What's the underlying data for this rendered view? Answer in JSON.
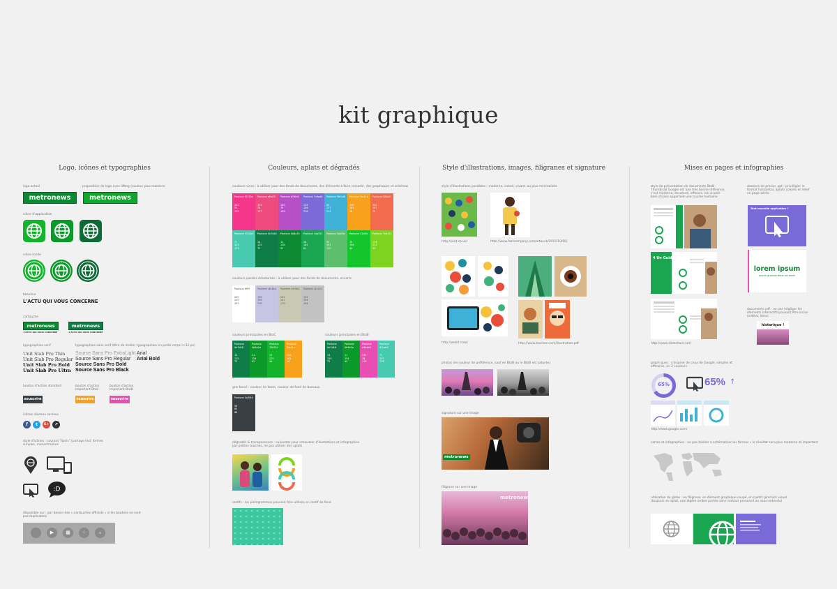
{
  "page": {
    "title": "kit graphique"
  },
  "columns": [
    "Logo, icônes et typographies",
    "Couleurs, aplats et dégradés",
    "Style d'illustrations, images, filigranes et signature",
    "Mises en pages et infographies"
  ],
  "col1": {
    "logo_actuel": "logo actuel",
    "logo_proposition": "proposition de logo avec lifting (couleur plus moderne",
    "logo_text": "metronews",
    "icone_application": "icône d'application",
    "icone_ronde": "icône ronde",
    "baseline_label": "baseline",
    "baseline_text": "L'ACTU QUI VOUS CONCERNE",
    "cartouche_label": "cartouche",
    "cartouche_sub": "L'ACTU QUI VOUS CONCERNE",
    "typo_serif": "typographies serif",
    "typo_sans": "typographies sans serif (titre de droite)",
    "typo_petit": "typographies en petits corps (<12 px)",
    "serif_fonts": [
      "Unit Slab Pro Thin",
      "Unit Slab Pro Regular",
      "Unit Slab Pro Bold",
      "Unit Slab Pro Ultra"
    ],
    "sans_fonts": [
      "Source Sans Pro ExtraLight",
      "Source Sans Pro Regular",
      "Source Sans Pro Bold",
      "Source Sans Pro Black"
    ],
    "small_fonts": [
      "Arial",
      "Arial Bold"
    ],
    "btn_labels": [
      "bouton d'action standard",
      "bouton d'action important BtoC",
      "bouton d'action important BtoB"
    ],
    "btn_text": "souscrire",
    "icones_sociaux": "icônes réseaux sociaux",
    "style_icones": "style d'icônes : courant \"lipsis\" (partage lisd, formes simples, monochromes",
    "disponible": "disponible sur : par besoin des « cartouches officiels » si les boutons ne sont pas duplicables"
  },
  "col2": {
    "couleurs_label": "couleurs vives : à utiliser pour des fonds de documents, des éléments à faire ressortir, des graphiques et schémas",
    "pastels_label": "couleurs pastels désaturées : à utiliser pour des fonds de documents, encarts",
    "btoc_label": "couleurs principales en BtoC",
    "btob_label": "couleurs principales en BtoB",
    "gris_label": "gris foncé : couleur de texte, couleur de fond de bureaux",
    "degrades_label": "dégradés & transparences : suivantes pour rehausser d'ilustrations et infographies par petites touches, ne pas utiliser des aplats",
    "motifs_label": "motifs : les pictogrammes peuvent être utilisés en motif de fond",
    "swatch_name": "Pantone",
    "row1": [
      {
        "c": "#f5358a",
        "hex": "f5358a",
        "rgb": "245 53 138"
      },
      {
        "c": "#ef4a7f",
        "hex": "ef4a7f",
        "rgb": "239 74 127"
      },
      {
        "c": "#b74fc6",
        "hex": "b74fc6",
        "rgb": "183 79 198"
      },
      {
        "c": "#7c6ad8",
        "hex": "7c6ad8",
        "rgb": "124 106 216"
      },
      {
        "c": "#3fb1d6",
        "hex": "3fb1d6",
        "rgb": "63 177 214"
      },
      {
        "c": "#f9a11a",
        "hex": "f9a11a",
        "rgb": "249 161 26"
      },
      {
        "c": "#f26b4f",
        "hex": "f26b4f",
        "rgb": "242 107 79"
      }
    ],
    "row2": [
      {
        "c": "#47cbb0",
        "hex": "47cbb0",
        "rgb": "71 203 176"
      },
      {
        "c": "#0e7d48",
        "hex": "0e7d48",
        "rgb": "14 125 72"
      },
      {
        "c": "#0b8a33",
        "hex": "0b8a33",
        "rgb": "11 138 51"
      },
      {
        "c": "#1aa551",
        "hex": "1aa551",
        "rgb": "26 165 81"
      },
      {
        "c": "#5dbf6e",
        "hex": "5dbf6e",
        "rgb": "93 191 110"
      },
      {
        "c": "#13c62c",
        "hex": "13c62c",
        "rgb": "19 198 44"
      },
      {
        "c": "#7ed321",
        "hex": "7ed321",
        "rgb": "126 211 33"
      }
    ],
    "pastels": [
      {
        "c": "#ffffff",
        "hex": "ffffff",
        "rgb": "255 255 255",
        "dark": true
      },
      {
        "c": "#c6c6e4",
        "hex": "c6c6e4",
        "rgb": "198 198 228",
        "dark": true
      },
      {
        "c": "#c9c9b3",
        "hex": "c9c9b3",
        "rgb": "201 201 179",
        "dark": true
      },
      {
        "c": "#c2c2c2",
        "hex": "c2c2c2",
        "rgb": "194 194 194",
        "dark": true
      }
    ],
    "btoc": [
      {
        "c": "#0e7d48",
        "hex": "0e7d48",
        "rgb": "14 125 72"
      },
      {
        "c": "#0b9a2a",
        "hex": "0b9a2a",
        "rgb": "11 154 42"
      },
      {
        "c": "#13b32c",
        "hex": "13b32c",
        "rgb": "19 179 44"
      },
      {
        "c": "#f9a11a",
        "hex": "f9a11a",
        "rgb": "249 161 26"
      }
    ],
    "btob": [
      {
        "c": "#0e7d48",
        "hex": "0e7d48",
        "rgb": "14 125 72"
      },
      {
        "c": "#0b9a2a",
        "hex": "0b9a2a",
        "rgb": "11 154 42"
      },
      {
        "c": "#e94eb3",
        "hex": "e94eb3",
        "rgb": "233 78 179"
      },
      {
        "c": "#47cbb0",
        "hex": "47cbb0",
        "rgb": "71 203 176"
      }
    ],
    "gris": {
      "c": "#3a3f44",
      "hex": "3a3f44",
      "rgb": "58 63 68"
    }
  },
  "col3": {
    "style_illus": "style d'illustrations possibles : moderne, coloré, vivant, au plus minimaliste",
    "credit1": "http://visit.co.uk/",
    "credit2": "http://www.fastcompany.com/artwork/2015/10/06/",
    "credit3": "http://webit.com/",
    "credit4": "http://www.taschen.com/illustration.pdf",
    "photos_label": "photos (en couleur de préférence, sauf en BtoB ou le BtoB est saturée)",
    "signature_label": "signature sur une image",
    "filigrane_label": "filigrane sur une image",
    "logo_text": "metronews"
  },
  "col4": {
    "style_pres": "style de présentation de documents BtoB : Thumbnail Google est une très bonne référence, c'est moderne, structuré, efficace, les visuels bien choisis apportent une touche humaine",
    "dossiers_label": "dossiers de presse, ppt : privilégier le format horizontal, aplats colorés et relief en page aérée",
    "doc_pdf": "documents pdf : ne pas négliger les éléments interactifs pouvant être inclus (vidéos, liens)",
    "historique": "historique !",
    "lorem": "lorem ipsum",
    "lorem_sub": "ipsum gravida dolor sit amet",
    "graph_label": "graph ques : s'inspirer de ceux de Google, simples et efficaces, en 2 couleurs",
    "pct1": "65%",
    "pct2": "65%",
    "cartes_label": "cartes et infographies : ne pas hésiter à schématiser les formes « le résultat sera plus moderne et impactant",
    "globe_label": "utilisation du globe : en filigrane, en élément graphique coupé, en (petit) gimmick visuel (toujours en aplat, une légère ombre portée sans contour prononcé en sous-entendu)",
    "new_app": "Tout nouvelle application !",
    "four_cards": "4 Un Guide"
  }
}
